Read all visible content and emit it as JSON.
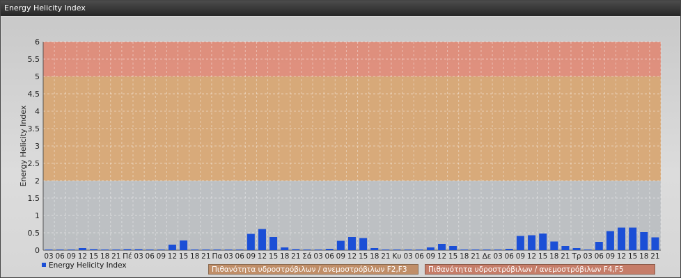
{
  "window": {
    "title": "Energy Helicity Index"
  },
  "colors": {
    "bar": "#1b4fd6",
    "zone_low": "#b9bcc0",
    "zone_mid": "#d7a46f",
    "zone_high": "#e08874"
  },
  "chart_data": {
    "type": "bar",
    "title": "",
    "ylabel": "Energy Helicity Index",
    "xlabel": "",
    "ylim": [
      0,
      6
    ],
    "yticks": [
      "0",
      "0.5",
      "1",
      "1.5",
      "2",
      "2.5",
      "3",
      "3.5",
      "4",
      "4.5",
      "5",
      "5.5",
      "6"
    ],
    "grid": true,
    "legend_position": "bottom-left",
    "categories": [
      "03",
      "06",
      "09",
      "12",
      "15",
      "18",
      "21",
      "Πέ",
      "03",
      "06",
      "09",
      "12",
      "15",
      "18",
      "21",
      "Πα",
      "03",
      "06",
      "09",
      "12",
      "15",
      "18",
      "21",
      "Σά",
      "03",
      "06",
      "09",
      "12",
      "15",
      "18",
      "21",
      "Κυ",
      "03",
      "06",
      "09",
      "12",
      "15",
      "18",
      "21",
      "Δε",
      "03",
      "06",
      "09",
      "12",
      "15",
      "18",
      "21",
      "Τρ",
      "03",
      "06",
      "09",
      "12",
      "15",
      "18",
      "21"
    ],
    "series": [
      {
        "name": "Energy Helicity Index",
        "values": [
          0.02,
          0.02,
          0.02,
          0.06,
          0.03,
          0.02,
          0.02,
          0.03,
          0.03,
          0.02,
          0.02,
          0.16,
          0.28,
          0.02,
          0.02,
          0.02,
          0.02,
          0.02,
          0.47,
          0.61,
          0.38,
          0.08,
          0.03,
          0.02,
          0.02,
          0.04,
          0.27,
          0.38,
          0.35,
          0.06,
          0.02,
          0.02,
          0.02,
          0.02,
          0.08,
          0.18,
          0.12,
          0.02,
          0.02,
          0.02,
          0.02,
          0.04,
          0.41,
          0.43,
          0.48,
          0.25,
          0.12,
          0.06,
          0.02,
          0.24,
          0.55,
          0.65,
          0.65,
          0.52,
          0.37
        ]
      }
    ],
    "zones": [
      {
        "from": 0,
        "to": 2,
        "label": ""
      },
      {
        "from": 2,
        "to": 5,
        "label": "Πιθανότητα υδροστρόβιλων / ανεμοστρόβιλων F2,F3"
      },
      {
        "from": 5,
        "to": 6,
        "label": "Πιθανότητα υδροστρόβιλων / ανεμοστρόβιλων F4,F5"
      }
    ]
  }
}
